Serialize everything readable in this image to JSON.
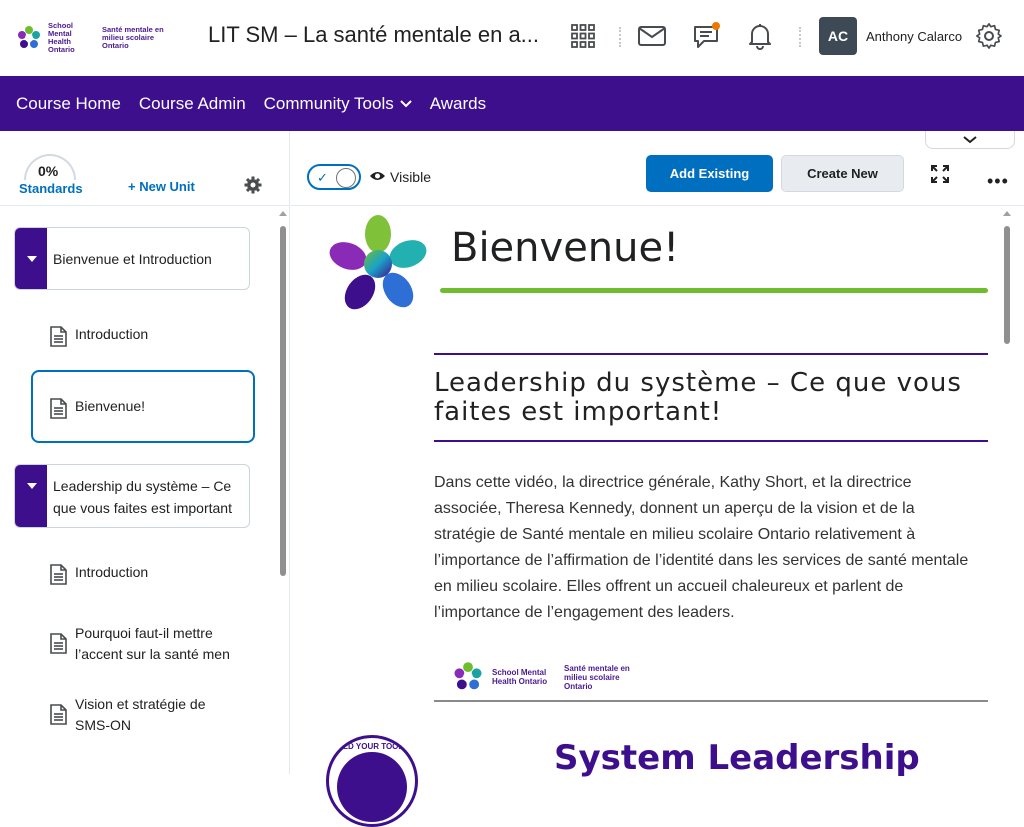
{
  "header": {
    "logo_en": "School Mental Health Ontario",
    "logo_fr": "Santé mentale en milieu scolaire Ontario",
    "course_title": "LIT SM – La santé mentale en a...",
    "user_initials": "AC",
    "user_name": "Anthony Calarco"
  },
  "nav": {
    "items": [
      "Course Home",
      "Course Admin",
      "Community Tools",
      "Awards"
    ]
  },
  "left_panel": {
    "progress": "0%",
    "standards_label": "Standards",
    "new_unit_label": "+ New Unit",
    "units": [
      {
        "label": "Bienvenue et Introduction",
        "lessons": [
          "Introduction",
          "Bienvenue!"
        ]
      },
      {
        "label": "Leadership du système – Ce que vous faites est important",
        "label_line1": "Leadership du système – Ce",
        "label_line2": "que vous faites est important",
        "lessons": [
          "Introduction",
          "Pourquoi faut-il mettre l’accent sur la santé men",
          "Vision et stratégie de SMS-ON"
        ],
        "lesson2_line1": "Pourquoi faut-il mettre",
        "lesson2_line2": "l’accent sur la santé men",
        "lesson3_line1": "Vision et stratégie de",
        "lesson3_line2": "SMS-ON"
      }
    ],
    "selected_lesson": "Bienvenue!"
  },
  "toolbar": {
    "visible_label": "Visible",
    "add_existing": "Add Existing",
    "create_new": "Create New"
  },
  "content": {
    "title": "Bienvenue!",
    "section_heading": "Leadership du système – Ce que vous faites est important!",
    "body": "Dans cette vidéo, la directrice générale, Kathy Short, et la directrice associée, Theresa Kennedy, donnent un aperçu de la vision et de la stratégie de Santé mentale en milieu scolaire Ontario relativement à l’importance de l’affirmation de l’identité dans les services de santé mentale en milieu scolaire. Elles offrent un accueil chaleureux et parlent de l’importance de l’engagement des leaders.",
    "small_logo_en": "School Mental Health Ontario",
    "small_logo_fr": "Santé mentale en milieu scolaire Ontario",
    "badge_text": "BUILD YOUR TOOLBOX",
    "banner_text": "System Leadership"
  },
  "colors": {
    "brand_purple": "#3e0f8c",
    "accent_blue": "#006fbf",
    "green_rule": "#6fbd2f",
    "notification_dot": "#f07800"
  },
  "icons": {
    "waffle": "grid-icon",
    "mail": "mail-icon",
    "chat": "chat-icon",
    "bell": "bell-icon",
    "settings": "gear-icon"
  }
}
